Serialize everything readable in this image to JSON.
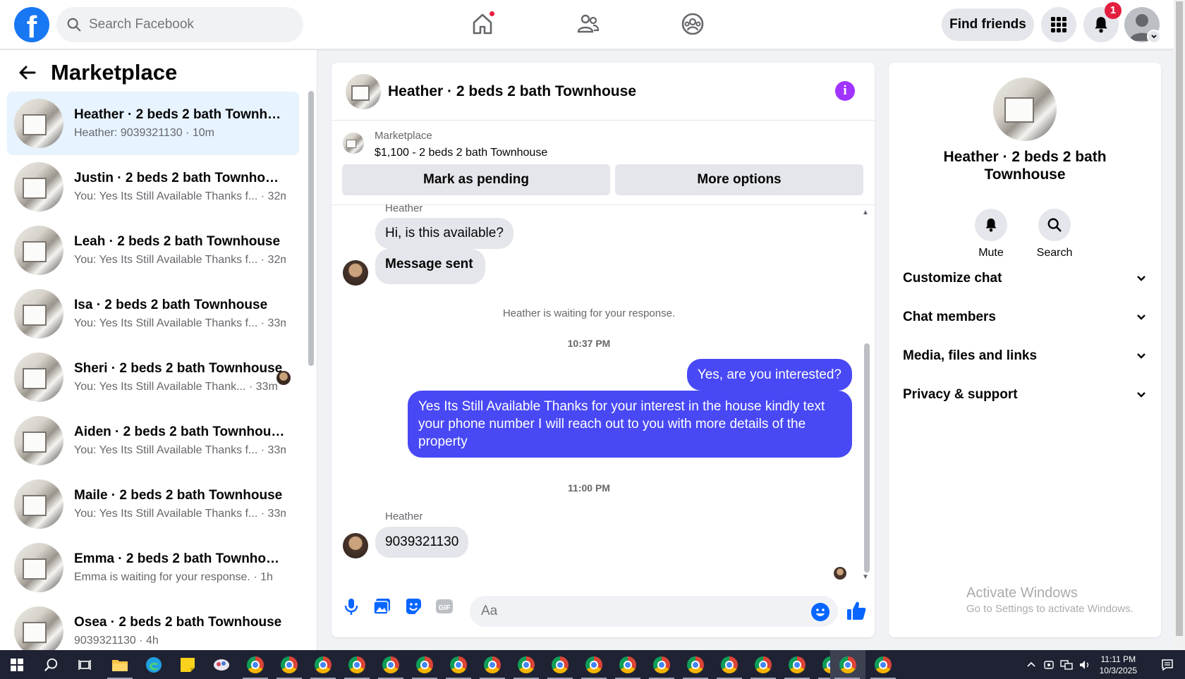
{
  "topbar": {
    "logo": "f",
    "search_placeholder": "Search Facebook",
    "find_friends_label": "Find friends",
    "notification_count": "1"
  },
  "left": {
    "title": "Marketplace",
    "conversations": [
      {
        "name": "Heather · 2 beds 2 bath Townho...",
        "sub": "Heather: 9039321130 · 10m",
        "active": true
      },
      {
        "name": "Justin · 2 beds 2 bath Townhouse",
        "sub": "You: Yes Its Still Available Thanks f... · 32m"
      },
      {
        "name": "Leah · 2 beds 2 bath Townhouse",
        "sub": "You: Yes Its Still Available Thanks f... · 32m"
      },
      {
        "name": "Isa · 2 beds 2 bath Townhouse",
        "sub": "You: Yes Its Still Available Thanks f... · 33m"
      },
      {
        "name": "Sheri · 2 beds 2 bath Townhouse",
        "sub": "You: Yes Its Still Available Thank... · 33m"
      },
      {
        "name": "Aiden · 2 beds 2 bath Townhouse",
        "sub": "You: Yes Its Still Available Thanks f... · 33m"
      },
      {
        "name": "Maile · 2 beds 2 bath Townhouse",
        "sub": "You: Yes Its Still Available Thanks f... · 33m"
      },
      {
        "name": "Emma · 2 beds 2 bath Townhouse",
        "sub": "Emma is waiting for your response. · 1h"
      },
      {
        "name": "Osea · 2 beds 2 bath Townhouse",
        "sub": "9039321130 · 4h"
      }
    ]
  },
  "chat": {
    "title": "Heather · 2 beds 2 bath Townhouse",
    "marketplace_label": "Marketplace",
    "listing": "$1,100 - 2 beds 2 bath Townhouse",
    "mark_pending_label": "Mark as pending",
    "more_options_label": "More options",
    "sender_name": "Heather",
    "msg_in_1": "Hi, is this available?",
    "msg_in_2": "Message sent",
    "waiting_text": "Heather is waiting for your response.",
    "time_1": "10:37 PM",
    "msg_out_1": "Yes, are you interested?",
    "msg_out_2": "Yes Its Still Available Thanks for your interest in the house kindly text your phone number I will reach out to you with more details of the property",
    "time_2": "11:00 PM",
    "sender_name_2": "Heather",
    "msg_in_3": "9039321130",
    "composer_placeholder": "Aa",
    "gif_label": "GIF"
  },
  "right": {
    "name": "Heather · 2 beds 2 bath Townhouse",
    "mute_label": "Mute",
    "search_label": "Search",
    "sections": [
      "Customize chat",
      "Chat members",
      "Media, files and links",
      "Privacy & support"
    ],
    "activate_title": "Activate Windows",
    "activate_sub": "Go to Settings to activate Windows."
  },
  "taskbar": {
    "time": "11:11 PM",
    "date": "10/3/2025"
  }
}
